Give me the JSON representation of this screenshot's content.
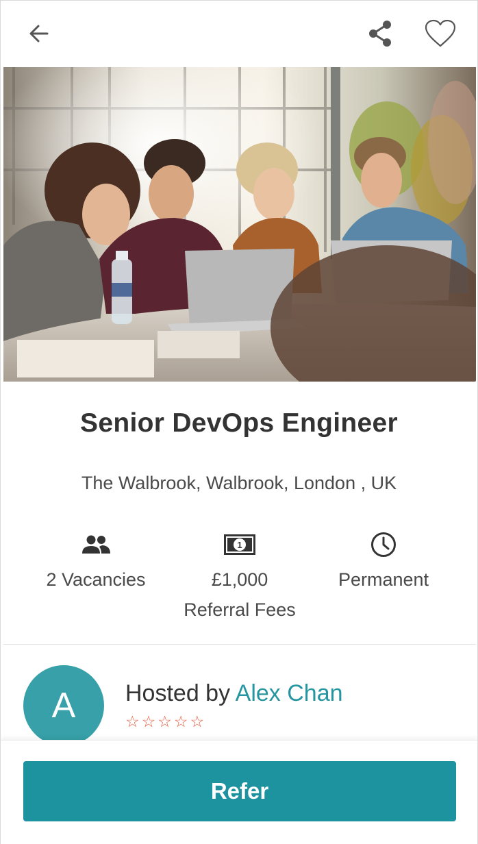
{
  "job": {
    "title": "Senior DevOps Engineer",
    "location": "The Walbrook, Walbrook, London , UK"
  },
  "stats": {
    "vacancies": "2 Vacancies",
    "fee_amount": "£1,000",
    "fee_label": "Referral Fees",
    "type": "Permanent"
  },
  "host": {
    "initial": "A",
    "prefix": "Hosted by ",
    "name": "Alex Chan",
    "rating_stars": "☆☆☆☆☆",
    "rating": 0,
    "rating_max": 5
  },
  "actions": {
    "refer_label": "Refer"
  },
  "carousel": {
    "current": 1,
    "total": 1
  },
  "colors": {
    "accent": "#1e93a0",
    "host_link": "#2596a1",
    "avatar": "#37a0a8",
    "stars": "#e85c3f"
  },
  "icons": {
    "back": "arrow-left-icon",
    "share": "share-icon",
    "favorite": "heart-outline-icon",
    "vacancies": "people-icon",
    "fee": "banknote-icon",
    "type": "clock-icon"
  }
}
